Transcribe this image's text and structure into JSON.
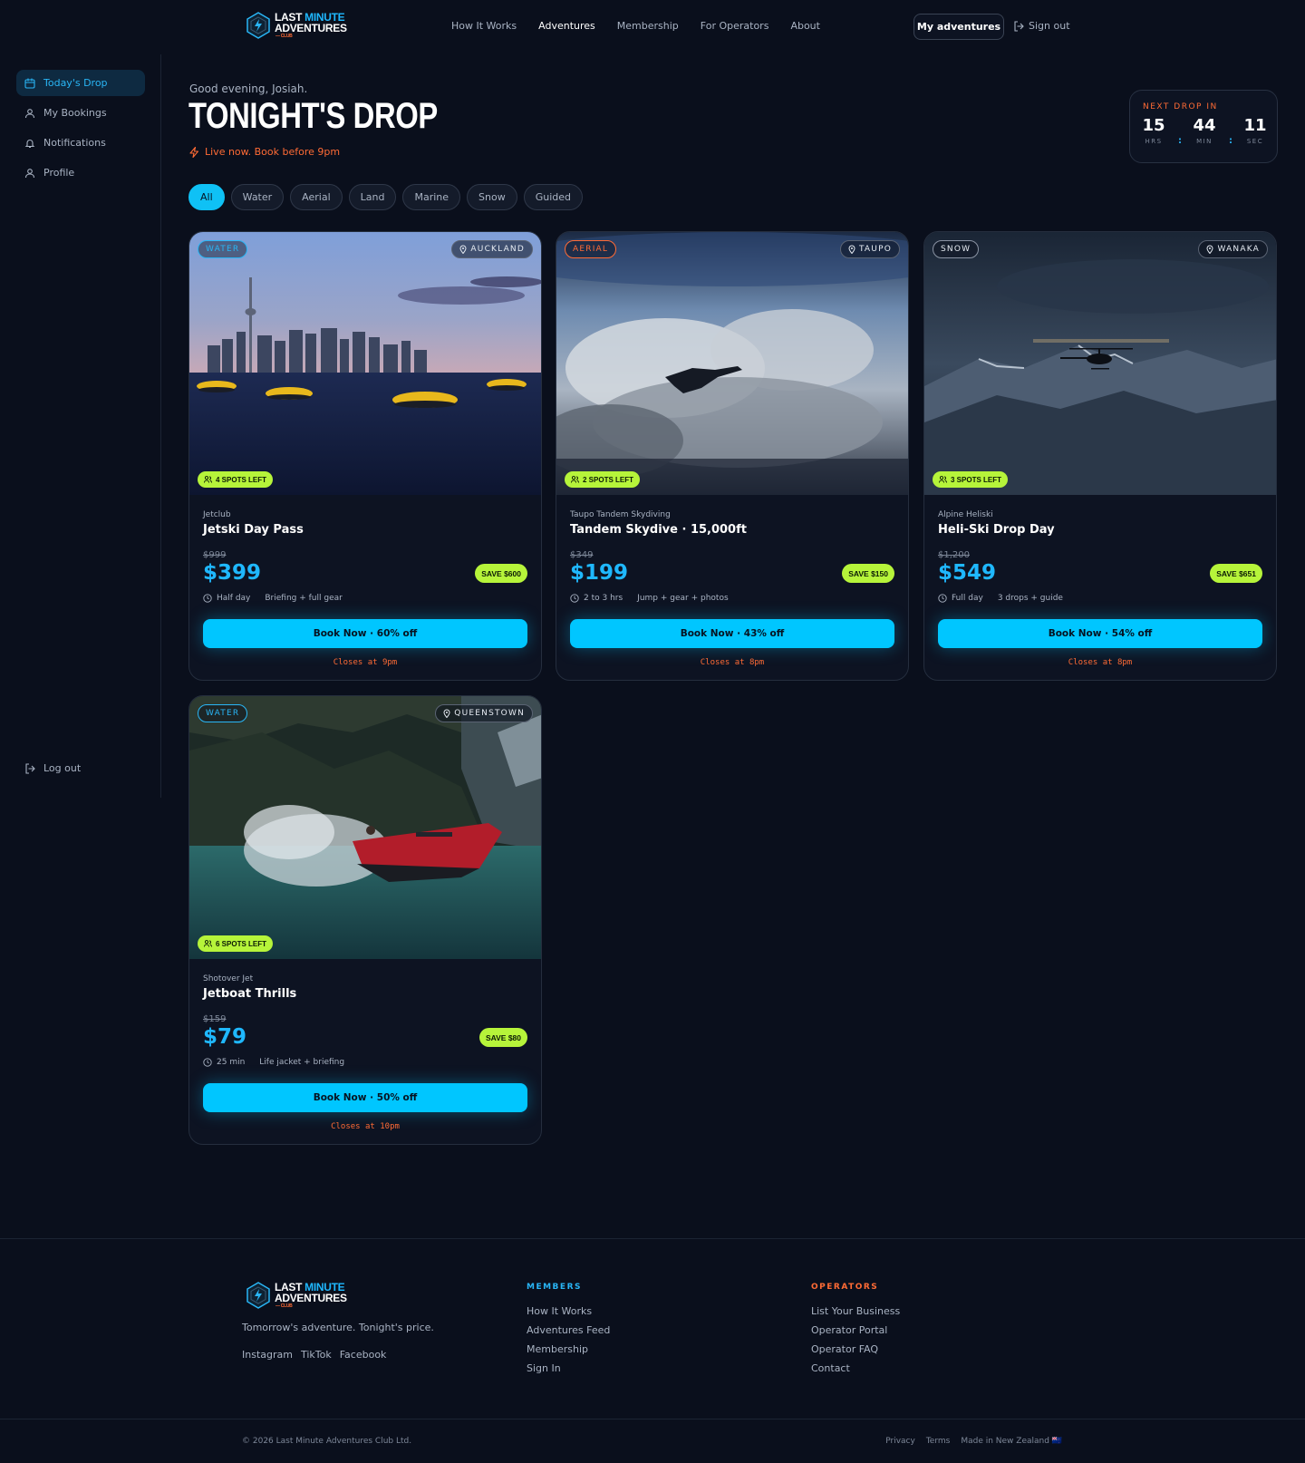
{
  "brand": {
    "line1a": "LAST ",
    "line1b": "MINUTE",
    "line2": "ADVENTURES",
    "line3": "— CLUB"
  },
  "nav": {
    "links": [
      "How It Works",
      "Adventures",
      "Membership",
      "For Operators",
      "About"
    ],
    "active": "Adventures",
    "my_adventures": "My adventures",
    "sign_out": "Sign out"
  },
  "sidebar": {
    "items": [
      {
        "label": "Today's Drop",
        "icon": "calendar-icon",
        "active": true
      },
      {
        "label": "My Bookings",
        "icon": "user-icon",
        "active": false
      },
      {
        "label": "Notifications",
        "icon": "bell-icon",
        "active": false
      },
      {
        "label": "Profile",
        "icon": "user-icon",
        "active": false
      }
    ],
    "logout": "Log out"
  },
  "header": {
    "greeting": "Good evening, Josiah.",
    "title": "TONIGHT'S DROP",
    "live": "Live now. Book before 9pm"
  },
  "countdown": {
    "label": "NEXT DROP IN",
    "hours": "15",
    "hours_label": "HRS",
    "minutes": "44",
    "minutes_label": "MIN",
    "seconds": "11",
    "seconds_label": "SEC"
  },
  "filters": [
    "All",
    "Water",
    "Aerial",
    "Land",
    "Marine",
    "Snow",
    "Guided"
  ],
  "active_filter": "All",
  "cards": [
    {
      "category": "WATER",
      "category_color": "#29b6f6",
      "location": "AUCKLAND",
      "spots": "4 SPOTS LEFT",
      "operator": "Jetclub",
      "name": "Jetski Day Pass",
      "old_price": "$999",
      "price": "$399",
      "save": "SAVE $600",
      "duration": "Half day",
      "includes": "Briefing + full gear",
      "book": "Book Now · 60% off",
      "closes": "Closes at 9pm"
    },
    {
      "category": "AERIAL",
      "category_color": "#ff6b35",
      "location": "TAUPO",
      "spots": "2 SPOTS LEFT",
      "operator": "Taupo Tandem Skydiving",
      "name": "Tandem Skydive · 15,000ft",
      "old_price": "$349",
      "price": "$199",
      "save": "SAVE $150",
      "duration": "2 to 3 hrs",
      "includes": "Jump + gear + photos",
      "book": "Book Now · 43% off",
      "closes": "Closes at 8pm"
    },
    {
      "category": "SNOW",
      "category_color": "#e6ebf2",
      "location": "WANAKA",
      "spots": "3 SPOTS LEFT",
      "operator": "Alpine Heliski",
      "name": "Heli-Ski Drop Day",
      "old_price": "$1,200",
      "price": "$549",
      "save": "SAVE $651",
      "duration": "Full day",
      "includes": "3 drops + guide",
      "book": "Book Now · 54% off",
      "closes": "Closes at 8pm"
    },
    {
      "category": "WATER",
      "category_color": "#29b6f6",
      "location": "QUEENSTOWN",
      "spots": "6 SPOTS LEFT",
      "operator": "Shotover Jet",
      "name": "Jetboat Thrills",
      "old_price": "$159",
      "price": "$79",
      "save": "SAVE $80",
      "duration": "25 min",
      "includes": "Life jacket + briefing",
      "book": "Book Now · 50% off",
      "closes": "Closes at 10pm"
    }
  ],
  "footer": {
    "tagline": "Tomorrow's adventure. Tonight's price.",
    "social": [
      "Instagram",
      "TikTok",
      "Facebook"
    ],
    "members_heading": "MEMBERS",
    "members": [
      "How It Works",
      "Adventures Feed",
      "Membership",
      "Sign In"
    ],
    "operators_heading": "OPERATORS",
    "operators": [
      "List Your Business",
      "Operator Portal",
      "Operator FAQ",
      "Contact"
    ],
    "copyright": "© 2026 Last Minute Adventures Club Ltd.",
    "legal": [
      "Privacy",
      "Terms",
      "Made in New Zealand 🇳🇿"
    ]
  },
  "colors": {
    "accent": "#00c6ff",
    "lime": "#b6f43a",
    "orange": "#ff6b35",
    "bg": "#0a0f1c"
  }
}
